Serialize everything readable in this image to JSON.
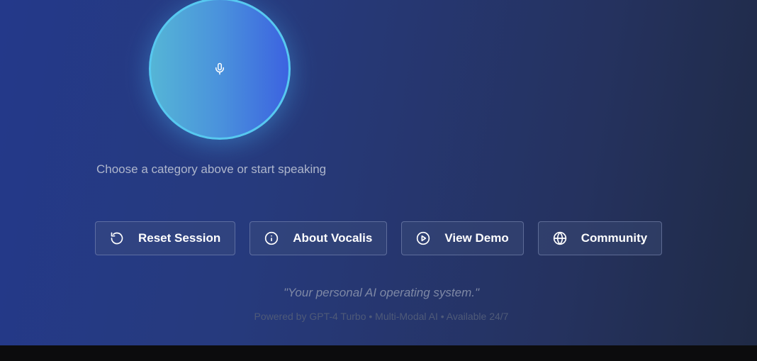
{
  "voice": {
    "mic_button_icon": "microphone-icon",
    "hint": "Choose a category above or start speaking"
  },
  "actions": [
    {
      "label": "Reset Session",
      "icon": "reset-icon"
    },
    {
      "label": "About Vocalis",
      "icon": "info-icon"
    },
    {
      "label": "View Demo",
      "icon": "play-icon"
    },
    {
      "label": "Community",
      "icon": "globe-icon"
    }
  ],
  "footer": {
    "tagline": "\"Your personal AI operating system.\"",
    "powered_by": "Powered by GPT-4 Turbo • Multi-Modal AI • Available 24/7"
  },
  "colors": {
    "mic_ring": "#57c8f0",
    "mic_fill_start": "#55b5d6",
    "mic_fill_end": "#3c63e0",
    "background_start": "#24398a",
    "background_end": "#1f2a45"
  }
}
